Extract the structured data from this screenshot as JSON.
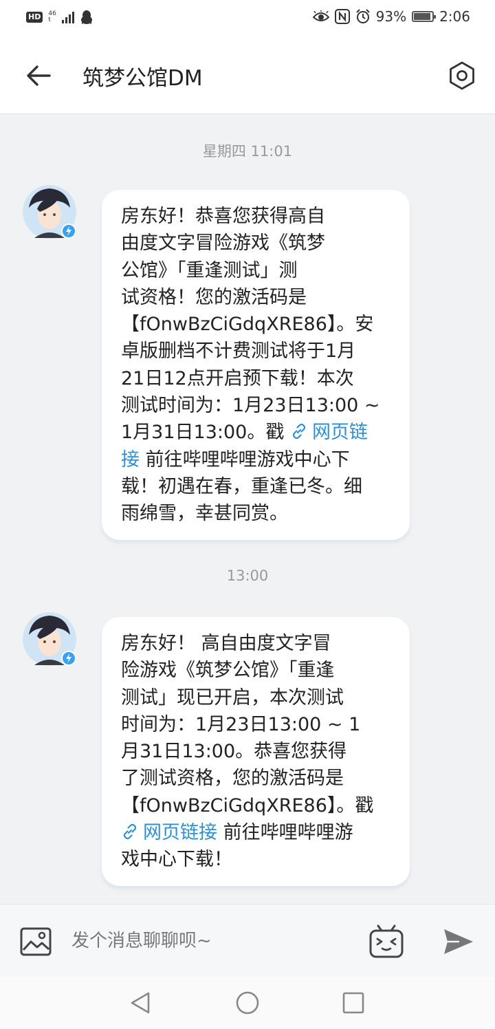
{
  "status_bar": {
    "hd": "HD",
    "net_top": "46",
    "net_bottom": "t",
    "battery": "93%",
    "battery_level": 0.93,
    "time": "2:06"
  },
  "header": {
    "title": "筑梦公馆DM"
  },
  "messages": [
    {
      "time": "星期四 11:01",
      "text_before": "房东好！恭喜您获得高自\n由度文字冒险游戏《筑梦\n公馆》「重逢测试」测\n试资格！您的激活码是\n【fOnwBzCiGdqXRE86】。安\n卓版删档不计费测试将于1月\n21日12点开启预下载！本次\n测试时间为：1月23日13:00 ~\n1月31日13:00。戳 ",
      "link": "网页链\n接",
      "text_after": " 前往哔哩哔哩游戏中心下\n载！初遇在春，重逢已冬。细\n雨绵雪，幸甚同赏。"
    },
    {
      "time": "13:00",
      "text_before": "房东好！ 高自由度文字冒\n险游戏《筑梦公馆》「重逢\n测试」现已开启，本次测试\n时间为：1月23日13:00 ~ 1\n月31日13:00。恭喜您获得\n了测试资格，您的激活码是\n【fOnwBzCiGdqXRE86】。戳\n",
      "link": "网页链接",
      "text_after": " 前往哔哩哔哩游\n戏中心下载！"
    }
  ],
  "input": {
    "placeholder": "发个消息聊聊呗~"
  },
  "colors": {
    "link": "#2f8fd0",
    "background": "#f1f2f3",
    "bubble": "#ffffff"
  }
}
